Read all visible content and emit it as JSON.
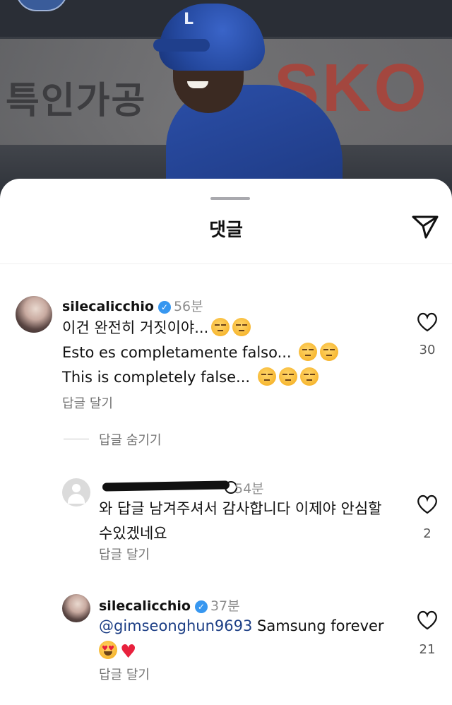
{
  "background_photo": {
    "banner_text_korean": "특인가공",
    "banner_text_brand": "SKO",
    "helmet_emblem": "L"
  },
  "sheet": {
    "title": "댓글",
    "send_icon": "send-icon"
  },
  "comments": [
    {
      "username": "silecalicchio",
      "verified": true,
      "time": "56분",
      "lines": [
        "이건 완전히 거짓이야...",
        "Esto es completamente falso...",
        "This is completely false..."
      ],
      "emojis": [
        "unamused",
        "unamused"
      ],
      "reply_label": "답글 달기",
      "likes": "30"
    }
  ],
  "hide_replies_label": "답글 숨기기",
  "replies": [
    {
      "username": "",
      "time": "54분",
      "text_line1": "와 답글 남겨주셔서 감사합니다 이제야 안심할",
      "text_line2": "수있겠네요",
      "reply_label": "답글 달기",
      "likes": "2"
    },
    {
      "username": "silecalicchio",
      "verified": true,
      "time": "37분",
      "mention": "@gimseonghun9693",
      "text": " Samsung forever",
      "reply_label": "답글 달기",
      "likes": "21"
    }
  ],
  "colors": {
    "verified": "#3797f0",
    "mention": "#1c3e85",
    "secondary_text": "#737373"
  }
}
